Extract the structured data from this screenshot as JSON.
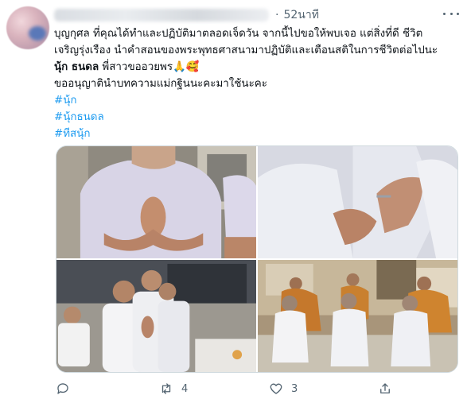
{
  "tweet": {
    "time": "52นาที",
    "time_dot": "·",
    "lines": [
      "บุญกุศล ที่คุณได้ทำและปฏิบัติมาตลอดเจ็ดวัน จากนี้ไปขอให้พบเจอ แต่สิ่งที่ดี ชีวิต",
      "เจริญรุ่งเรือง นำคำสอนของพระพุทธศาสนามาปฏิบัติและเตือนสติในการชีวิตต่อไปนะ"
    ],
    "bold_name": "นุ้ก ธนดล",
    "after_name": " พี่สาวขออวยพร🙏🥰",
    "credit_line": "ขออนุญาตินำบทความแม่กฐินนะคะมาใช้นะคะ",
    "hashtags": [
      "#นุ้ก",
      "#นุ้กธนดล",
      "#ทีสนุ้ก"
    ]
  },
  "media": {
    "photos": [
      "ordination-wai-closeup-1",
      "ordination-wai-closeup-2",
      "ordination-group-kneeling",
      "ordination-monks-ceremony"
    ]
  },
  "actions": {
    "reply_icon": "reply-icon",
    "retweet_icon": "retweet-icon",
    "retweet_count": "4",
    "like_icon": "heart-icon",
    "like_count": "3",
    "share_icon": "share-icon"
  },
  "colors": {
    "link": "#1d9bf0",
    "muted": "#536471",
    "border": "#cfd9de"
  }
}
